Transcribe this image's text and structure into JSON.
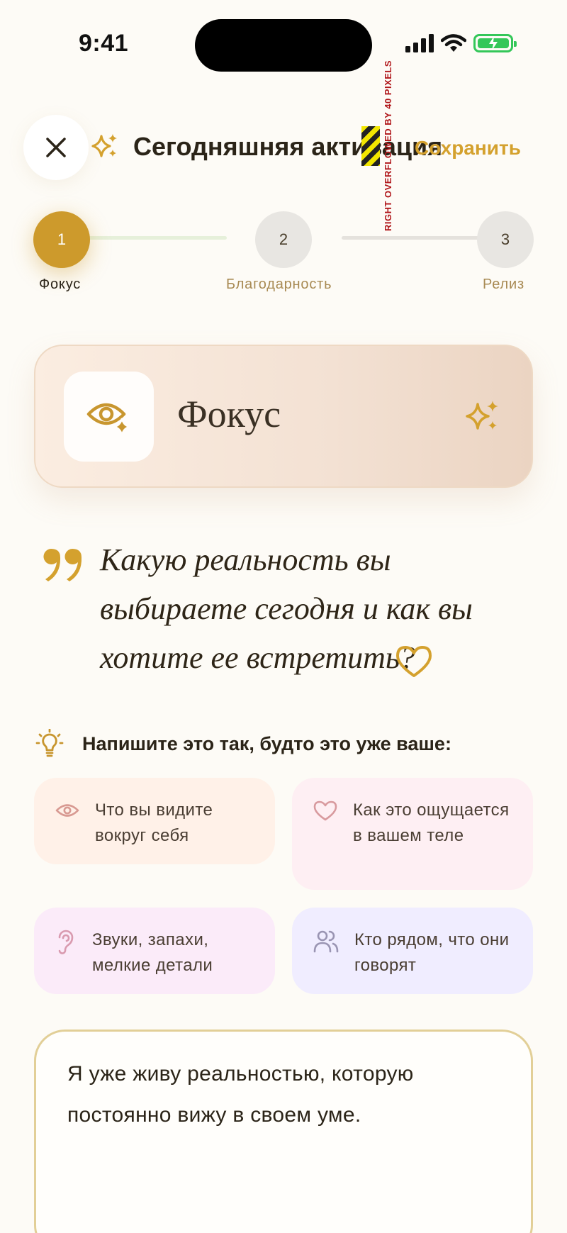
{
  "status_bar": {
    "time": "9:41"
  },
  "header": {
    "title": "Сегодняшняя активация",
    "save_label": "Сохранить",
    "overflow_warning": "RIGHT OVERFLOWED BY 40 PIXELS"
  },
  "stepper": {
    "current": 1,
    "steps": [
      {
        "number": "1",
        "label": "Фокус"
      },
      {
        "number": "2",
        "label": "Благодарность"
      },
      {
        "number": "3",
        "label": "Релиз"
      }
    ]
  },
  "focus_card": {
    "title": "Фокус"
  },
  "prompt": {
    "question": "Какую реальность вы выбираете сегодня и как вы хотите ее встретить?"
  },
  "hint": {
    "title": "Напишите это так, будто это уже ваше:",
    "chips": [
      {
        "icon": "eye-icon",
        "text": "Что вы видите вокруг себя"
      },
      {
        "icon": "heart-icon",
        "text": "Как это ощущается в вашем теле"
      },
      {
        "icon": "ear-icon",
        "text": "Звуки, запахи, мелкие детали"
      },
      {
        "icon": "people-icon",
        "text": "Кто рядом, что они говорят"
      }
    ]
  },
  "answer": {
    "value": "Я уже живу реальностью, которую постоянно вижу в своем уме."
  },
  "colors": {
    "accent": "#D4A12E",
    "background": "#FDFBF6",
    "step_active": "#CD9A2C"
  }
}
